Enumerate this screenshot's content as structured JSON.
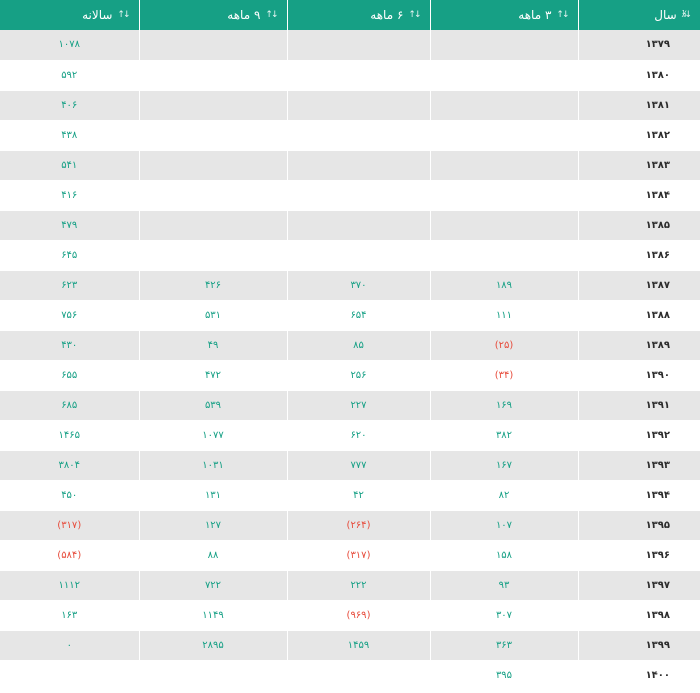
{
  "columns": [
    {
      "label": "سال",
      "icon": "sort-numeric-icon"
    },
    {
      "label": "۳ ماهه",
      "icon": "sort-arrows-icon"
    },
    {
      "label": "۶ ماهه",
      "icon": "sort-arrows-icon"
    },
    {
      "label": "۹ ماهه",
      "icon": "sort-arrows-icon"
    },
    {
      "label": "سالانه",
      "icon": "sort-arrows-icon"
    }
  ],
  "colors": {
    "header": "#16a085",
    "positive": "#16a085",
    "negative": "#e74c3c",
    "stripe": "#e6e6e6"
  },
  "rows": [
    {
      "year": "۱۳۷۹",
      "q3": "",
      "q6": "",
      "q9": "",
      "annual": "۱۰۷۸"
    },
    {
      "year": "۱۳۸۰",
      "q3": "",
      "q6": "",
      "q9": "",
      "annual": "۵۹۲"
    },
    {
      "year": "۱۳۸۱",
      "q3": "",
      "q6": "",
      "q9": "",
      "annual": "۴۰۶"
    },
    {
      "year": "۱۳۸۲",
      "q3": "",
      "q6": "",
      "q9": "",
      "annual": "۴۳۸"
    },
    {
      "year": "۱۳۸۳",
      "q3": "",
      "q6": "",
      "q9": "",
      "annual": "۵۴۱"
    },
    {
      "year": "۱۳۸۴",
      "q3": "",
      "q6": "",
      "q9": "",
      "annual": "۴۱۶"
    },
    {
      "year": "۱۳۸۵",
      "q3": "",
      "q6": "",
      "q9": "",
      "annual": "۴۷۹"
    },
    {
      "year": "۱۳۸۶",
      "q3": "",
      "q6": "",
      "q9": "",
      "annual": "۶۴۵"
    },
    {
      "year": "۱۳۸۷",
      "q3": "۱۸۹",
      "q6": "۳۷۰",
      "q9": "۴۲۶",
      "annual": "۶۲۳"
    },
    {
      "year": "۱۳۸۸",
      "q3": "۱۱۱",
      "q6": "۶۵۴",
      "q9": "۵۳۱",
      "annual": "۷۵۶"
    },
    {
      "year": "۱۳۸۹",
      "q3": "(۲۵)",
      "q6": "۸۵",
      "q9": "۴۹",
      "annual": "۴۳۰"
    },
    {
      "year": "۱۳۹۰",
      "q3": "(۳۴)",
      "q6": "۲۵۶",
      "q9": "۴۷۲",
      "annual": "۶۵۵"
    },
    {
      "year": "۱۳۹۱",
      "q3": "۱۶۹",
      "q6": "۲۲۷",
      "q9": "۵۳۹",
      "annual": "۶۸۵"
    },
    {
      "year": "۱۳۹۲",
      "q3": "۳۸۲",
      "q6": "۶۲۰",
      "q9": "۱۰۷۷",
      "annual": "۱۴۶۵"
    },
    {
      "year": "۱۳۹۳",
      "q3": "۱۶۷",
      "q6": "۷۷۷",
      "q9": "۱۰۳۱",
      "annual": "۳۸۰۴"
    },
    {
      "year": "۱۳۹۴",
      "q3": "۸۲",
      "q6": "۴۲",
      "q9": "۱۳۱",
      "annual": "۴۵۰"
    },
    {
      "year": "۱۳۹۵",
      "q3": "۱۰۷",
      "q6": "(۲۶۴)",
      "q9": "۱۲۷",
      "annual": "(۳۱۷)"
    },
    {
      "year": "۱۳۹۶",
      "q3": "۱۵۸",
      "q6": "(۳۱۷)",
      "q9": "۸۸",
      "annual": "(۵۸۴)"
    },
    {
      "year": "۱۳۹۷",
      "q3": "۹۳",
      "q6": "۲۲۲",
      "q9": "۷۲۲",
      "annual": "۱۱۱۲"
    },
    {
      "year": "۱۳۹۸",
      "q3": "۳۰۷",
      "q6": "(۹۶۹)",
      "q9": "۱۱۴۹",
      "annual": "۱۶۳"
    },
    {
      "year": "۱۳۹۹",
      "q3": "۳۶۳",
      "q6": "۱۴۵۹",
      "q9": "۲۸۹۵",
      "annual": "۰"
    },
    {
      "year": "۱۴۰۰",
      "q3": "۳۹۵",
      "q6": "",
      "q9": "",
      "annual": ""
    }
  ]
}
